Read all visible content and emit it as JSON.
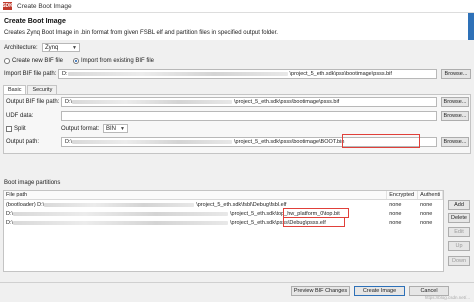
{
  "window": {
    "icon_text": "SDK",
    "title": "Create Boot Image"
  },
  "header": {
    "title": "Create Boot Image",
    "description": "Creates Zynq Boot Image in .bin format from given FSBL elf and partition files in specified output folder."
  },
  "architecture": {
    "label": "Architecture:",
    "value": "Zynq"
  },
  "bif_mode": {
    "new_label": "Create new BIF file",
    "import_label": "Import from existing BIF file",
    "selected": "import"
  },
  "import_bif": {
    "label": "Import BIF file path:",
    "path_suffix": "\\project_5_eth.sdk\\pss\\bootimage\\psss.bif",
    "browse": "Browse..."
  },
  "tabs": {
    "basic": "Basic",
    "security": "Security"
  },
  "output_bif": {
    "label": "Output BIF file path:",
    "path_prefix": "D:\\",
    "path_suffix": "\\project_5_eth.sdk\\psss\\bootimage\\psss.bif",
    "browse": "Browse..."
  },
  "udf": {
    "label": "UDF data:",
    "value": "",
    "browse": "Browse..."
  },
  "split": {
    "label": "Split",
    "format_label": "Output format:",
    "format_value": "BIN"
  },
  "output_path": {
    "label": "Output path:",
    "path_prefix": "D:\\",
    "path_suffix": "\\project_5_eth.sdk\\psss\\bootimage\\BOOT.bin",
    "browse": "Browse..."
  },
  "partitions": {
    "section_label": "Boot image partitions",
    "columns": [
      "File path",
      "Encrypted",
      "Authenti"
    ],
    "rows": [
      {
        "prefix": "(bootloader) D:\\",
        "suffix": "\\project_5_eth.sdk\\fsbl\\Debug\\fsbl.elf",
        "encrypted": "none",
        "auth": "none"
      },
      {
        "prefix": "D:\\",
        "suffix": "\\project_5_eth.sdk\\top_hw_platform_0\\top.bit",
        "encrypted": "none",
        "auth": "none"
      },
      {
        "prefix": "D:\\",
        "suffix": "\\project_5_eth.sdk\\psss\\Debug\\psss.elf",
        "encrypted": "none",
        "auth": "none"
      }
    ]
  },
  "side_buttons": [
    "Add",
    "Delete",
    "Edit",
    "Up",
    "Down"
  ],
  "footer": {
    "preview": "Preview BIF Changes",
    "create": "Create Image",
    "cancel": "Cancel"
  },
  "watermark": "https://blog.csdn.net/..."
}
